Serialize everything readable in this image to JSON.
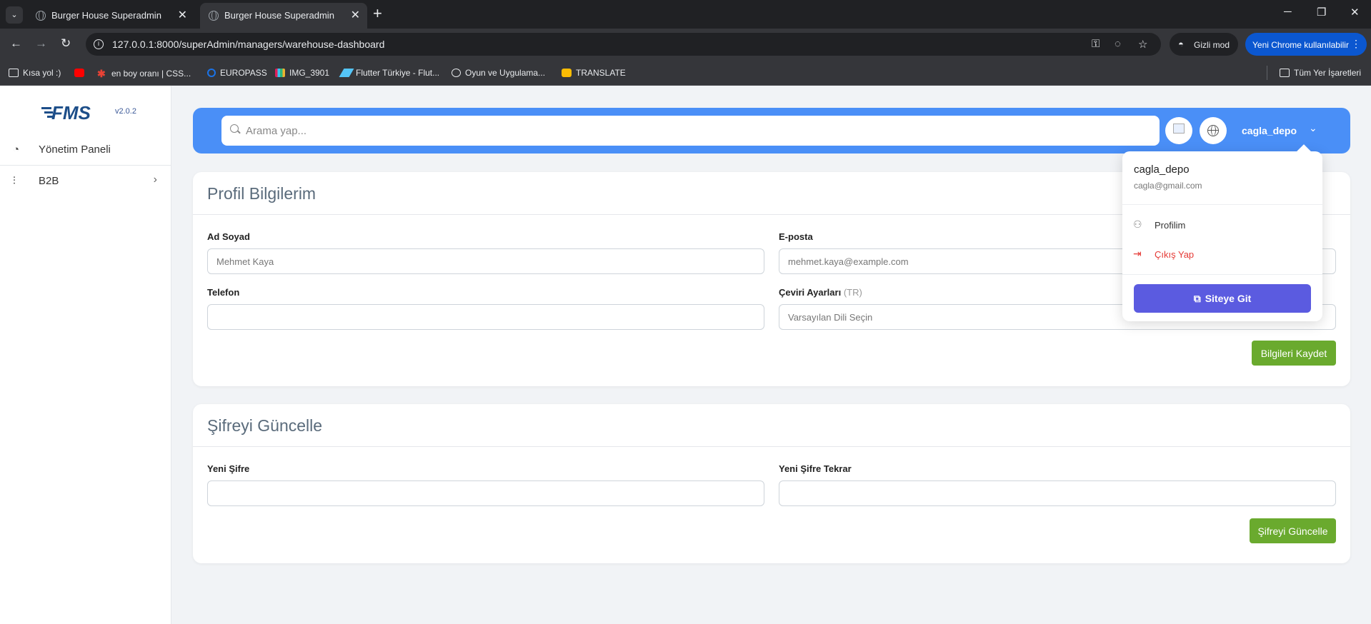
{
  "browser": {
    "tabs": [
      {
        "title": "Burger House Superadmin",
        "active": false
      },
      {
        "title": "Burger House Superadmin",
        "active": true
      }
    ],
    "url": "127.0.0.1:8000/superAdmin/managers/warehouse-dashboard",
    "incognito_label": "Gizli mod",
    "profile_label": "Yeni Chrome kullanılabilir",
    "bookmarks": [
      {
        "label": "Kısa yol :)",
        "icon": "folder-icon"
      },
      {
        "label": "",
        "icon": "youtube-icon"
      },
      {
        "label": "en boy oranı | CSS...",
        "icon": "asterisk-icon"
      },
      {
        "label": "EUROPASS",
        "icon": "europass-icon"
      },
      {
        "label": "IMG_3901",
        "icon": "slack-icon"
      },
      {
        "label": "Flutter Türkiye - Flut...",
        "icon": "flutter-icon"
      },
      {
        "label": "Oyun ve Uygulama...",
        "icon": "globe-icon"
      },
      {
        "label": "TRANSLATE",
        "icon": "translate-icon"
      }
    ],
    "all_bookmarks_label": "Tüm Yer İşaretleri"
  },
  "sidebar": {
    "logo_text": "FMS",
    "version": "v2.0.2",
    "items": [
      {
        "label": "Yönetim Paneli",
        "icon": "pie-chart-icon"
      },
      {
        "label": "B2B",
        "icon": "sliders-icon"
      }
    ]
  },
  "topbar": {
    "search_placeholder": "Arama yap...",
    "username": "cagla_depo"
  },
  "user_menu": {
    "name": "cagla_depo",
    "email": "cagla@gmail.com",
    "profile_label": "Profilim",
    "logout_label": "Çıkış Yap",
    "site_button_label": "Siteye Git"
  },
  "profile_card": {
    "title": "Profil Bilgilerim",
    "fullname_label": "Ad Soyad",
    "fullname_placeholder": "Mehmet Kaya",
    "email_label": "E-posta",
    "email_placeholder": "mehmet.kaya@example.com",
    "phone_label": "Telefon",
    "phone_value": "",
    "translation_label": "Çeviri Ayarları",
    "translation_hint": "(TR)",
    "translation_placeholder": "Varsayılan Dili Seçin",
    "save_button": "Bilgileri Kaydet"
  },
  "password_card": {
    "title": "Şifreyi Güncelle",
    "new_password_label": "Yeni Şifre",
    "new_password_repeat_label": "Yeni Şifre Tekrar",
    "update_button": "Şifreyi Güncelle"
  },
  "colors": {
    "topbar": "#4a8ff7",
    "green_button": "#6aaa2e",
    "site_button": "#5b5be0",
    "logout_red": "#e53935"
  }
}
